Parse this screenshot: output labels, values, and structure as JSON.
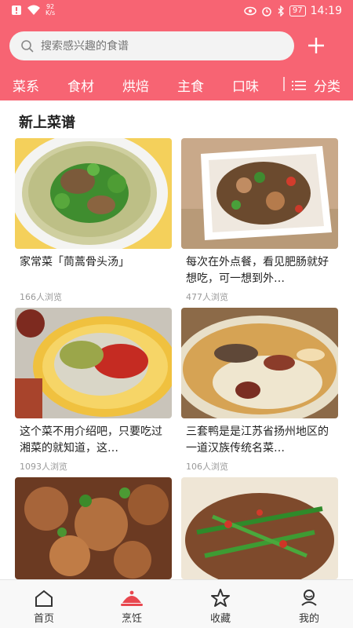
{
  "status_bar": {
    "network_speed": "92",
    "network_unit": "K/s",
    "battery": "97",
    "time": "14:19"
  },
  "search": {
    "placeholder": "搜索感兴趣的食谱"
  },
  "categories": [
    "菜系",
    "食材",
    "烘焙",
    "主食",
    "口味"
  ],
  "category_all_label": "分类",
  "section_title": "新上菜谱",
  "recipes": [
    {
      "title": "家常菜「茼蒿骨头汤」",
      "views": "166人浏览"
    },
    {
      "title": "每次在外点餐，看见肥肠就好想吃，可一想到外…",
      "views": "477人浏览"
    },
    {
      "title": "这个菜不用介绍吧，只要吃过湘菜的就知道，这…",
      "views": "1093人浏览"
    },
    {
      "title": "三套鸭是是江苏省扬州地区的一道汉族传统名菜…",
      "views": "106人浏览"
    }
  ],
  "bottom_nav": [
    "首页",
    "烹饪",
    "收藏",
    "我的"
  ],
  "colors": {
    "brand": "#f76473",
    "active_tab": "#e8474f"
  }
}
